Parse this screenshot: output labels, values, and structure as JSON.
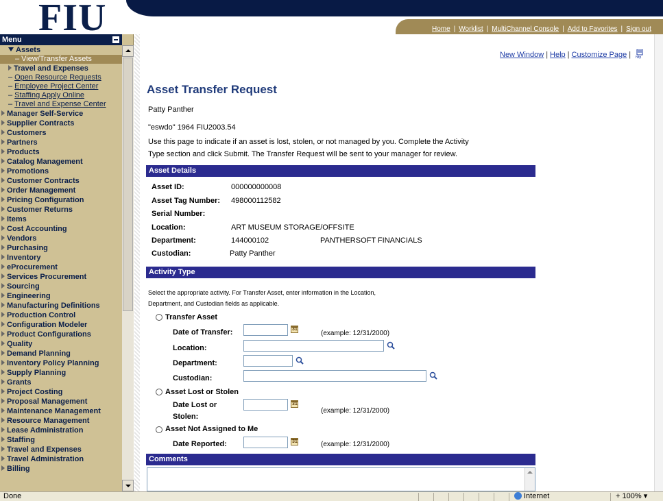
{
  "header": {
    "logo_text": "FIU",
    "links": [
      "Home",
      "Worklist",
      "MultiChannel Console",
      "Add to Favorites",
      "Sign out"
    ]
  },
  "menu": {
    "title": "Menu",
    "open_section": "Assets",
    "selected_item": "– View/Transfer Assets",
    "subsection": "Travel and Expenses",
    "sub_links": [
      "Open Resource Requests",
      "Employee Project Center",
      "Staffing Apply Online",
      "Travel and Expense Center"
    ],
    "items": [
      "Manager Self-Service",
      "Supplier Contracts",
      "Customers",
      "Partners",
      "Products",
      "Catalog Management",
      "Promotions",
      "Customer Contracts",
      "Order Management",
      "Pricing Configuration",
      "Customer Returns",
      "Items",
      "Cost Accounting",
      "Vendors",
      "Purchasing",
      "Inventory",
      "eProcurement",
      "Services Procurement",
      "Sourcing",
      "Engineering",
      "Manufacturing Definitions",
      "Production Control",
      "Configuration Modeler",
      "Product Configurations",
      "Quality",
      "Demand Planning",
      "Inventory Policy Planning",
      "Supply Planning",
      "Grants",
      "Project Costing",
      "Proposal Management",
      "Maintenance Management",
      "Resource Management",
      "Lease Administration",
      "Staffing",
      "Travel and Expenses",
      "Travel Administration",
      "Billing"
    ]
  },
  "top_links": {
    "new_window": "New Window",
    "help": "Help",
    "customize": "Customize Page"
  },
  "page": {
    "title": "Asset Transfer Request",
    "user": "Patty Panther",
    "asset_line": "\"eswdo\" 1964  FIU2003.54",
    "instructions_1": "Use this page to indicate if an asset is lost, stolen, or not managed by you. Complete the Activity",
    "instructions_2": "Type section and click Submit. The Transfer Request will be sent to your manager for review."
  },
  "asset_details": {
    "heading": "Asset Details",
    "asset_id_label": "Asset ID:",
    "asset_id": "000000000008",
    "tag_label": "Asset Tag Number:",
    "tag": "498000112582",
    "serial_label": "Serial Number:",
    "location_label": "Location:",
    "location": "ART MUSEUM STORAGE/OFFSITE",
    "department_label": "Department:",
    "department_code": "144000102",
    "department_name": "PANTHERSOFT FINANCIALS",
    "custodian_label": "Custodian:",
    "custodian": "Patty Panther"
  },
  "activity": {
    "heading": "Activity Type",
    "help_1": "Select the appropriate activity. For Transfer Asset, enter information in the Location,",
    "help_2": "Department, and Custodian fields as applicable.",
    "transfer_label": "Transfer Asset",
    "date_transfer_label": "Date of Transfer:",
    "location_label": "Location:",
    "department_label": "Department:",
    "custodian_label": "Custodian:",
    "lost_label": "Asset Lost or Stolen",
    "date_lost_label_1": "Date Lost or",
    "date_lost_label_2": "Stolen:",
    "not_assigned_label": "Asset Not Assigned to Me",
    "date_reported_label": "Date Reported:",
    "example": "(example: 12/31/2000)"
  },
  "comments": {
    "heading": "Comments"
  },
  "status_bar": {
    "status": "Done",
    "zone": "Internet",
    "zoom": "100%"
  },
  "colors": {
    "navy": "#0b1f4a",
    "gold": "#a08a56",
    "band": "#2b2b8f",
    "menu_bg": "#cfc195"
  }
}
